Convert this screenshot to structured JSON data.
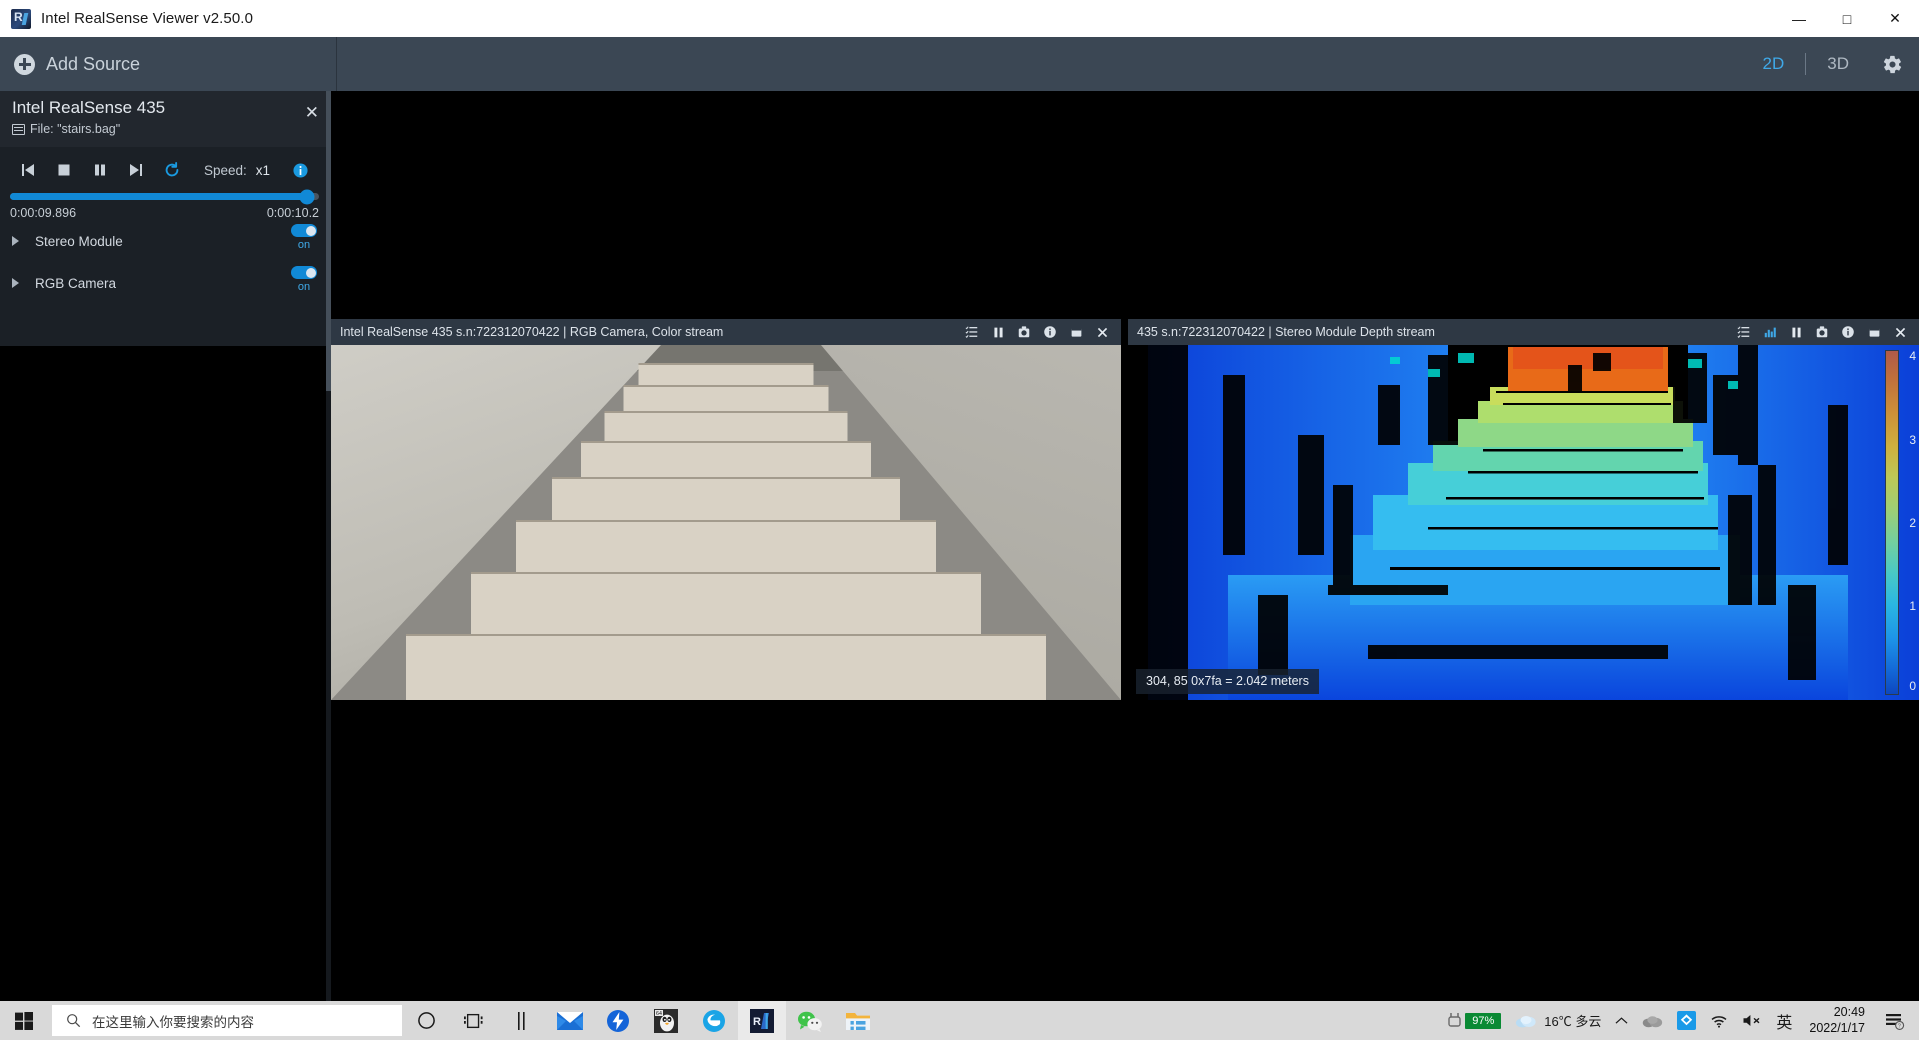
{
  "window": {
    "title": "Intel RealSense Viewer v2.50.0",
    "logo_icon": "realsense-logo-icon",
    "controls": [
      {
        "name": "minimize",
        "glyph": "—"
      },
      {
        "name": "maximize",
        "glyph": "□"
      },
      {
        "name": "close",
        "glyph": "✕"
      }
    ]
  },
  "toolbar": {
    "add_source_label": "Add Source",
    "add_source_icon": "plus-circle-icon",
    "view_modes": [
      {
        "label": "2D",
        "active": true
      },
      {
        "label": "3D",
        "active": false
      }
    ],
    "settings_icon": "gear-icon"
  },
  "device_panel": {
    "device_name": "Intel RealSense 435",
    "file_icon": "film-strip-icon",
    "file_label": "File: \"stairs.bag\"",
    "close_glyph": "✕",
    "playback": {
      "buttons": [
        {
          "name": "skip-to-start-button",
          "icon": "skip-previous-icon"
        },
        {
          "name": "stop-button",
          "icon": "stop-square-icon"
        },
        {
          "name": "pause-button",
          "icon": "pause-bars-icon"
        },
        {
          "name": "skip-to-end-button",
          "icon": "skip-next-icon"
        },
        {
          "name": "repeat-button",
          "icon": "loop-arrow-icon"
        }
      ],
      "speed_label": "Speed:",
      "speed_value": "x1",
      "info_icon": "info-circle-icon"
    },
    "seek": {
      "progress_percent": 96,
      "current_time": "0:00:09.896",
      "total_time": "0:00:10.2"
    },
    "sensors": [
      {
        "label": "Stereo Module",
        "expand_icon": "triangle-right-icon",
        "toggle_state": "on"
      },
      {
        "label": "RGB Camera",
        "expand_icon": "triangle-right-icon",
        "toggle_state": "on"
      }
    ]
  },
  "streams": [
    {
      "id": "rgb",
      "title": "Intel RealSense 435 s.n:722312070422 | RGB Camera, Color stream",
      "icons": [
        {
          "name": "metadata-list-icon",
          "glyph": "list"
        },
        {
          "name": "pause-icon",
          "glyph": "pause"
        },
        {
          "name": "snapshot-camera-icon",
          "glyph": "camera"
        },
        {
          "name": "info-circle-icon",
          "glyph": "info"
        },
        {
          "name": "maximize-panel-icon",
          "glyph": "maximize"
        },
        {
          "name": "close-stream-icon",
          "glyph": "close"
        }
      ]
    },
    {
      "id": "depth",
      "title": "435 s.n:722312070422 | Stereo Module Depth stream",
      "icons": [
        {
          "name": "metadata-list-icon",
          "glyph": "list"
        },
        {
          "name": "histogram-chart-icon",
          "glyph": "chart"
        },
        {
          "name": "pause-icon",
          "glyph": "pause"
        },
        {
          "name": "snapshot-camera-icon",
          "glyph": "camera"
        },
        {
          "name": "info-circle-icon",
          "glyph": "info"
        },
        {
          "name": "maximize-panel-icon",
          "glyph": "maximize"
        },
        {
          "name": "close-stream-icon",
          "glyph": "close"
        }
      ],
      "tooltip": "304, 85 0x7fa = 2.042 meters",
      "colorbar": {
        "unit": "meters",
        "ticks": [
          "4",
          "3",
          "2",
          "1",
          "0"
        ],
        "min": 0,
        "max": 4
      }
    }
  ],
  "taskbar": {
    "start_icon": "windows-start-icon",
    "search_icon": "search-magnifier-icon",
    "search_placeholder": "在这里输入你要搜索的内容",
    "apps": [
      {
        "name": "cortana-icon"
      },
      {
        "name": "task-view-icon"
      },
      {
        "name": "window-split-icon"
      },
      {
        "name": "mail-icon"
      },
      {
        "name": "bolt-app-icon"
      },
      {
        "name": "wsl-tux-icon"
      },
      {
        "name": "edge-icon"
      },
      {
        "name": "realsense-viewer-icon",
        "active": true
      },
      {
        "name": "wechat-icon"
      },
      {
        "name": "file-explorer-icon"
      }
    ],
    "tray": {
      "battery_percent": "97%",
      "battery_icon": "battery-charging-icon",
      "weather_icon": "cloud-icon",
      "weather": "16℃ 多云",
      "chevron_icon": "chevron-up-icon",
      "onedrive_icon": "onedrive-cloud-icon",
      "app_icon": "blue-square-app-icon",
      "network_icon": "wifi-icon",
      "volume_icon": "volume-muted-icon",
      "ime_label": "英",
      "clock_time": "20:49",
      "clock_date": "2022/1/17",
      "notification_icon": "notifications-icon"
    }
  }
}
